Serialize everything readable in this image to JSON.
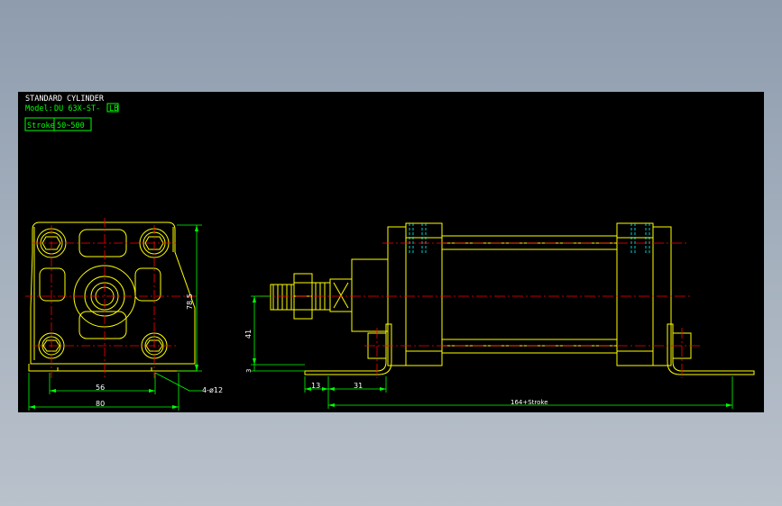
{
  "title_block": {
    "title": "STANDARD CYLINDER",
    "model_prefix": "Model:",
    "model_value": "DU 63X-ST-",
    "model_badge": "LB",
    "stroke_label": "Stroke",
    "stroke_range": "50~500"
  },
  "dimensions": {
    "height_side": "78.5",
    "width_inner": "56",
    "width_total": "80",
    "hole_spec": "4-ø12",
    "axis_height": "41",
    "base_thickness": "3",
    "dim_13": "13",
    "dim_31": "31",
    "overall_length": "164+Stroke"
  },
  "colors": {
    "background": "#000000",
    "outline": "#ffff00",
    "centerline": "#ff0000",
    "dimension": "#00ff00",
    "hidden": "#00ffff",
    "text": "#ffffff"
  }
}
